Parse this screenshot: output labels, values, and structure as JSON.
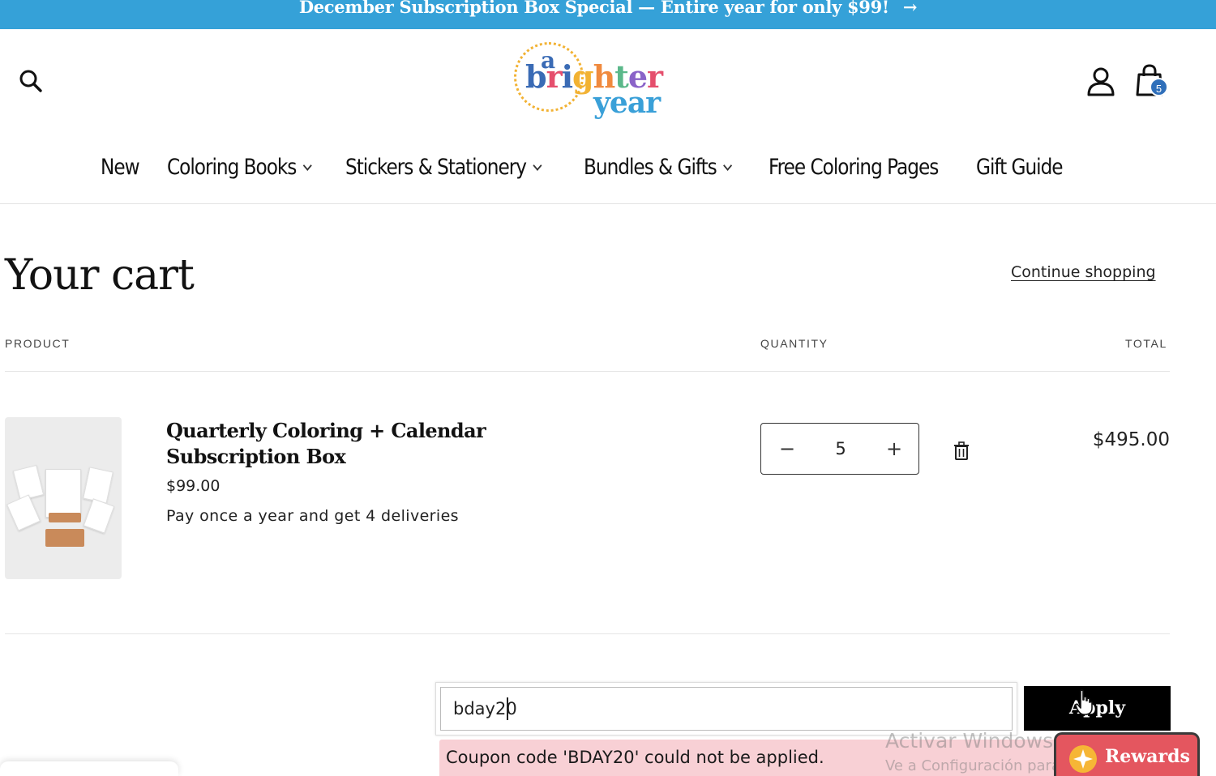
{
  "announcement": {
    "text": "December Subscription Box Special — Entire year for only $99!",
    "arrow": "→"
  },
  "header": {
    "logo": {
      "small": "a",
      "word1": "brighter",
      "word2": "year"
    },
    "cart_count": "5",
    "icons": {
      "search": "search-icon",
      "account": "user-icon",
      "cart": "shopping-bag-icon"
    }
  },
  "nav": {
    "items": [
      {
        "label": "New",
        "has_dropdown": false
      },
      {
        "label": "Coloring Books",
        "has_dropdown": true
      },
      {
        "label": "Stickers & Stationery",
        "has_dropdown": true
      },
      {
        "label": "Bundles & Gifts",
        "has_dropdown": true
      },
      {
        "label": "Free Coloring Pages",
        "has_dropdown": false
      },
      {
        "label": "Gift Guide",
        "has_dropdown": false
      }
    ]
  },
  "cart": {
    "title": "Your cart",
    "continue_label": "Continue shopping",
    "columns": {
      "product": "PRODUCT",
      "quantity": "QUANTITY",
      "total": "TOTAL"
    },
    "items": [
      {
        "name": "Quarterly Coloring + Calendar Subscription Box",
        "price": "$99.00",
        "description": "Pay once a year and get 4 deliveries",
        "quantity": "5",
        "line_total": "$495.00"
      }
    ]
  },
  "coupon": {
    "value": "bday20",
    "apply_label": "Apply",
    "error": "Coupon code 'BDAY20' could not be applied."
  },
  "watermark": {
    "line1": "Activar Windows",
    "line2": "Ve a Configuración para activar Windows."
  },
  "rewards": {
    "label": "Rewards"
  },
  "colors": {
    "announcement_bg": "#35a1d8",
    "badge": "#2f6fba",
    "error_bg": "#f8d0d5",
    "rewards_bg": "#e4565f"
  }
}
